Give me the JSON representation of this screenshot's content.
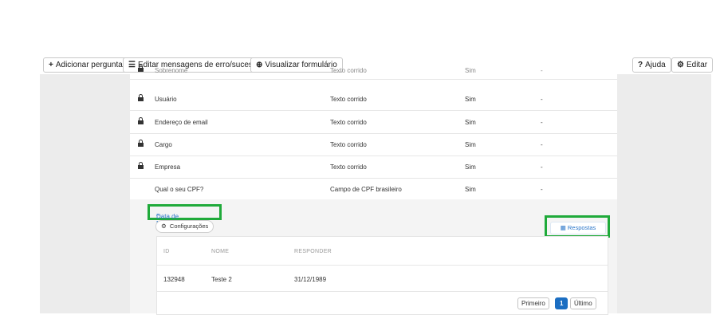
{
  "toolbar": {
    "add_question": "Adicionar pergunta",
    "edit_messages": "Editar mensagens de erro/sucesso",
    "view_form": "Visualizar formulário",
    "help": "Ajuda",
    "edit": "Editar"
  },
  "fields": [
    {
      "name": "Sobrenome",
      "type": "Texto corrido",
      "required": "Sim",
      "extra": "-"
    },
    {
      "name": "Usuário",
      "type": "Texto corrido",
      "required": "Sim",
      "extra": "-"
    },
    {
      "name": "Endereço de email",
      "type": "Texto corrido",
      "required": "Sim",
      "extra": "-"
    },
    {
      "name": "Cargo",
      "type": "Texto corrido",
      "required": "Sim",
      "extra": "-"
    },
    {
      "name": "Empresa",
      "type": "Texto corrido",
      "required": "Sim",
      "extra": "-"
    },
    {
      "name": "Qual o seu CPF?",
      "type": "Campo de CPF brasileiro",
      "required": "Sim",
      "extra": "-"
    }
  ],
  "expanded_field": {
    "label": "Data de Nascimento",
    "config_label": "Configurações",
    "responses_label": "Respostas"
  },
  "responses_table": {
    "headers": [
      "ID",
      "NOME",
      "RESPONDER"
    ],
    "rows": [
      {
        "id": "132948",
        "name": "Teste 2",
        "answer": "31/12/1989"
      }
    ]
  },
  "pagination": {
    "first": "Primeiro",
    "page": "1",
    "last": "Último"
  },
  "colors": {
    "highlight": "#1faa3a",
    "link": "#2a76c9",
    "active_page": "#1b6ec2"
  }
}
